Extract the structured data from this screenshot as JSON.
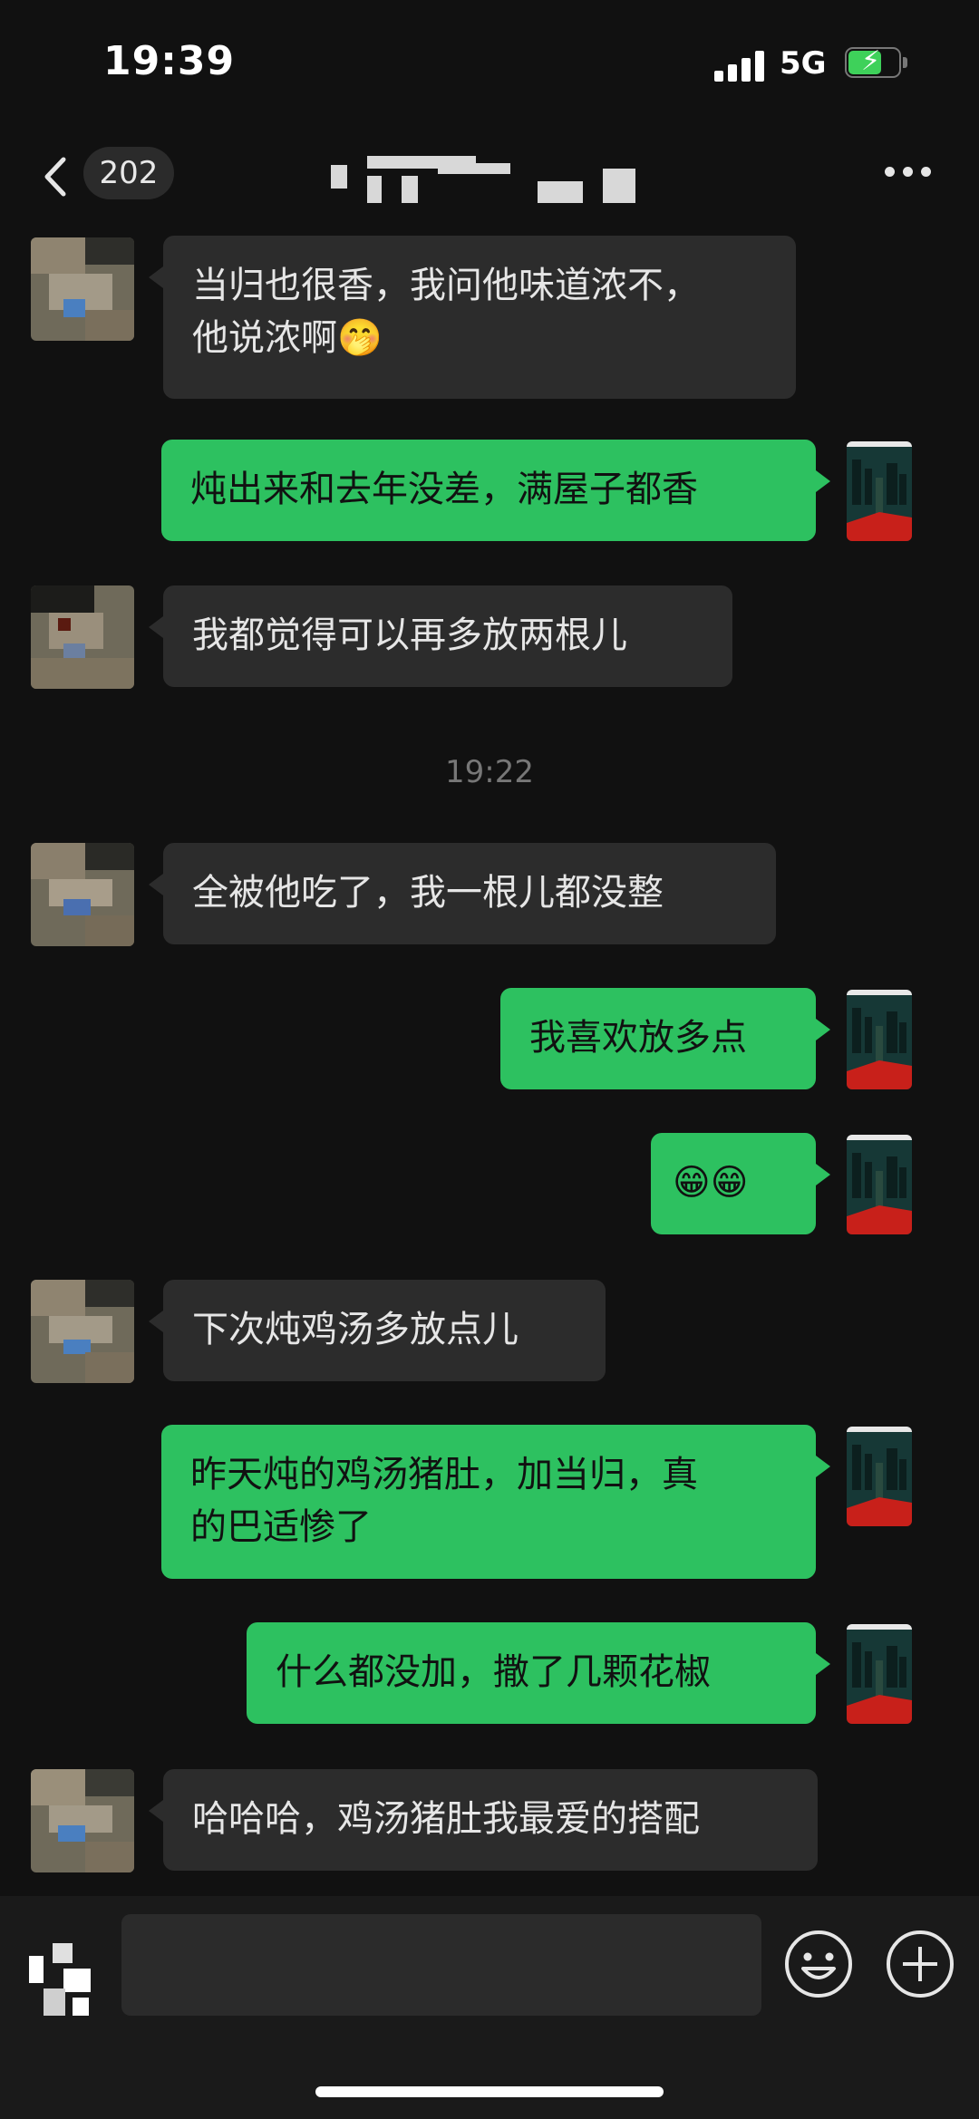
{
  "status_bar": {
    "time": "19:39",
    "network": "5G"
  },
  "nav": {
    "unread_count": "202"
  },
  "messages": [
    {
      "side": "left",
      "text": "当归也很香，我问他味道浓不，\n他说浓啊🤭"
    },
    {
      "side": "right",
      "text": "炖出来和去年没差，满屋子都香"
    },
    {
      "side": "left",
      "text": "我都觉得可以再多放两根儿"
    },
    {
      "side": "left",
      "text": "全被他吃了，我一根儿都没整"
    },
    {
      "side": "right",
      "text": "我喜欢放多点"
    },
    {
      "side": "right",
      "text": "😁😁"
    },
    {
      "side": "left",
      "text": "下次炖鸡汤多放点儿"
    },
    {
      "side": "right",
      "text": "昨天炖的鸡汤猪肚，加当归，真\n的巴适惨了"
    },
    {
      "side": "right",
      "text": "什么都没加，撒了几颗花椒"
    },
    {
      "side": "left",
      "text": "哈哈哈，鸡汤猪肚我最爱的搭配"
    }
  ],
  "timestamp": "19:22",
  "input": {
    "placeholder": ""
  },
  "colors": {
    "sent_bubble": "#2dc160",
    "received_bubble": "#2c2c2c",
    "background": "#111111"
  },
  "icons": [
    "back-icon",
    "more-icon",
    "voice-icon",
    "emoji-icon",
    "add-icon"
  ]
}
